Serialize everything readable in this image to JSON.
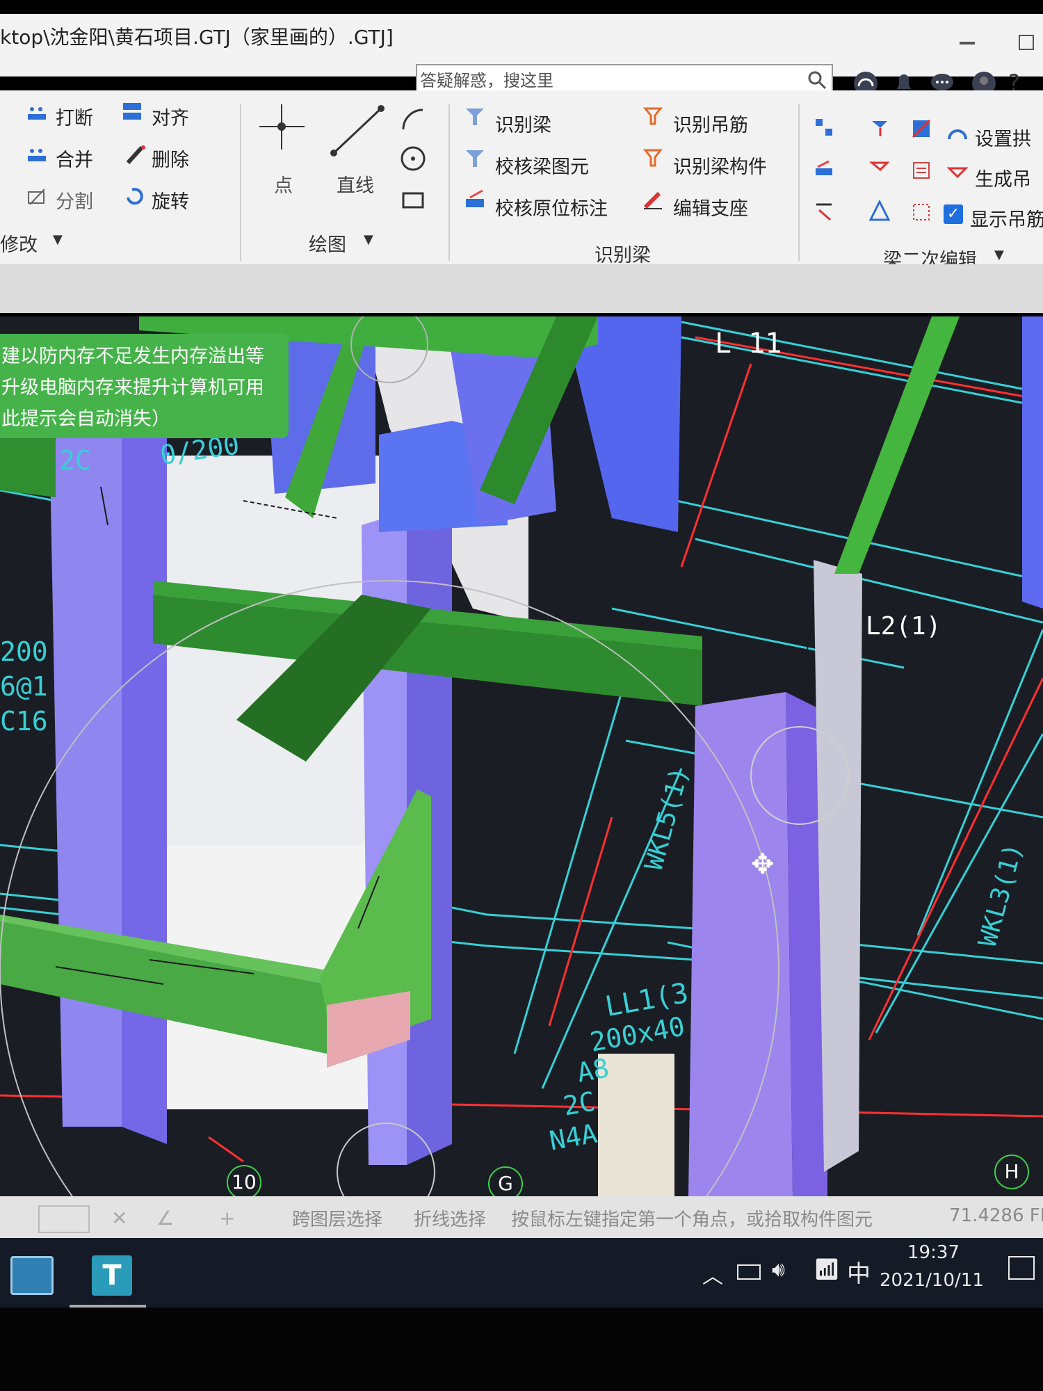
{
  "window": {
    "title": "ktop\\沈金阳\\黄石项目.GTJ（家里画的）.GTJ]",
    "search_placeholder": "答疑解惑，搜这里"
  },
  "ribbon": {
    "modify": {
      "title": "修改",
      "items": [
        "打断",
        "合并",
        "分割",
        "对齐",
        "删除",
        "旋转"
      ]
    },
    "draw": {
      "title": "绘图",
      "items": [
        "点",
        "直线"
      ]
    },
    "recognize_beam": {
      "title": "识别梁",
      "items": [
        "识别梁",
        "校核梁图元",
        "校核原位标注",
        "识别吊筋",
        "识别梁构件",
        "编辑支座"
      ]
    },
    "beam_edit": {
      "title": "梁二次编辑",
      "items": [
        "设置拱",
        "生成吊",
        "显示吊筋"
      ]
    }
  },
  "viewport": {
    "tooltip_lines": [
      "建以防内存不足发生内存溢出等",
      "升级电脑内存来提升计算机可用",
      "此提示会自动消失）"
    ],
    "labels": {
      "l11": "L 11",
      "l2": "L2(1)",
      "wkl5": "WKL5(1)",
      "wkl3": "WKL3(1)",
      "ll1": "LL1(3",
      "ll1_size": "200x40",
      "ll1_a": "A8",
      "ll1_b": "2C",
      "ll1_c": "N4A",
      "left1": "200",
      "left2": "6@1",
      "left3": "C16",
      "top_left": "2C",
      "top_mid": "0/200"
    },
    "axes": [
      "10",
      "G",
      "H"
    ],
    "colors": {
      "column": "#8f86f0",
      "beam": "#2e8a2e",
      "wall": "#e8e8e8",
      "grid": "#36d0d6",
      "axis_red": "#ff3030"
    }
  },
  "statusbar": {
    "items": [
      "跨图层选择",
      "折线选择",
      "按鼠标左键指定第一个角点，或拾取构件图元"
    ],
    "fps": "71.4286 FP"
  },
  "taskbar": {
    "ime": "中",
    "time": "19:37",
    "date": "2021/10/11"
  }
}
